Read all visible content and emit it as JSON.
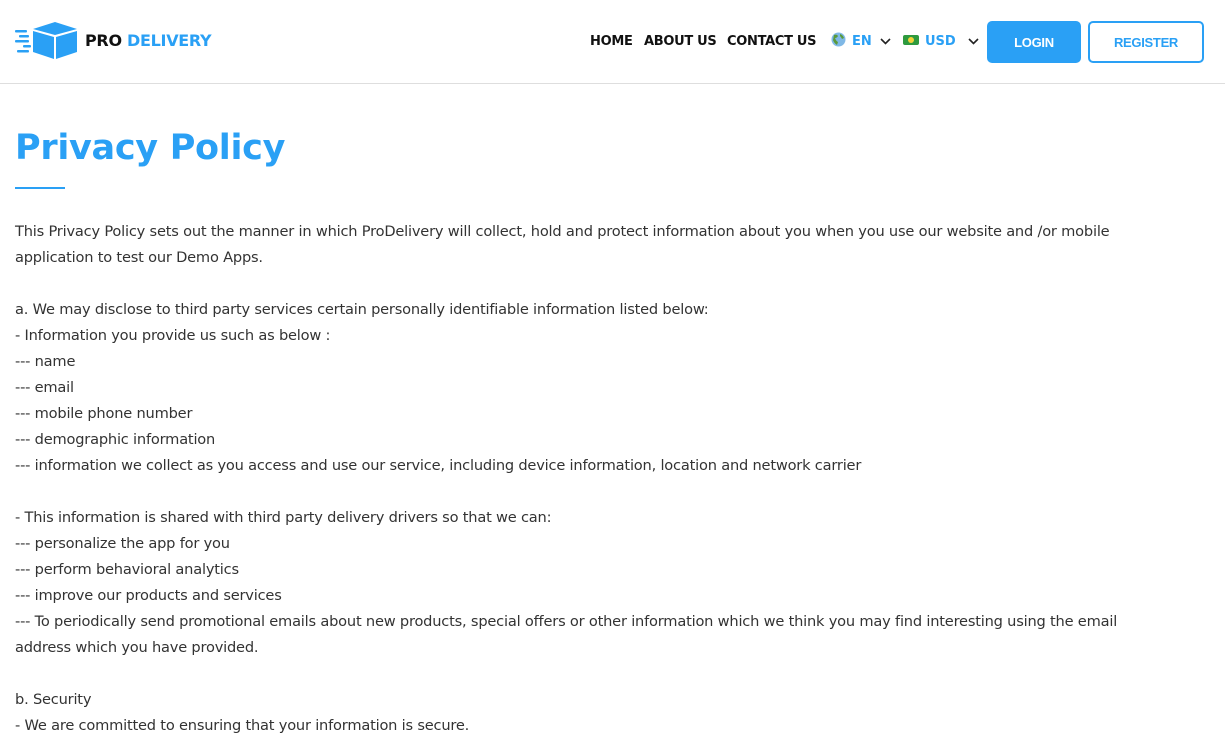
{
  "brand": {
    "logo_icon": "delivery-box-icon",
    "name_part1": "PRO",
    "name_part2": "DELIVERY"
  },
  "nav": {
    "links": [
      {
        "label": "HOME"
      },
      {
        "label": "ABOUT US"
      },
      {
        "label": "CONTACT US"
      }
    ],
    "language": {
      "icon": "globe-icon",
      "value": "EN"
    },
    "currency": {
      "icon": "banknote-icon",
      "value": "USD"
    },
    "login_label": "LOGIN",
    "register_label": "REGISTER"
  },
  "colors": {
    "accent": "#2aa0f5",
    "text": "#333333",
    "nav_text": "#111111"
  },
  "page": {
    "title": "Privacy Policy",
    "intro": [
      "This Privacy Policy sets out the manner in which ProDelivery will collect, hold and protect information about you when you use our website and /or mobile",
      "application to test our Demo Apps."
    ],
    "section_a": {
      "heading": "a. We may disclose to third party services certain personally identifiable information listed below:",
      "provided_heading": "- Information you provide us such as below :",
      "provided_items": [
        "--- name",
        "--- email",
        "--- mobile phone number",
        "--- demographic information",
        "--- information we collect as you access and use our service, including device information, location and network carrier"
      ],
      "shared_heading": "- This information is shared with third party delivery drivers so that we can:",
      "shared_items": [
        "--- personalize the app for you",
        "--- perform behavioral analytics",
        "--- improve our products and services",
        "--- To periodically send promotional emails about new products, special offers or other information which we think you may find interesting using the email",
        "address which you have provided."
      ]
    },
    "section_b": {
      "heading": "b. Security",
      "partial_line": "- We are committed to ensuring that your information is secure."
    }
  }
}
